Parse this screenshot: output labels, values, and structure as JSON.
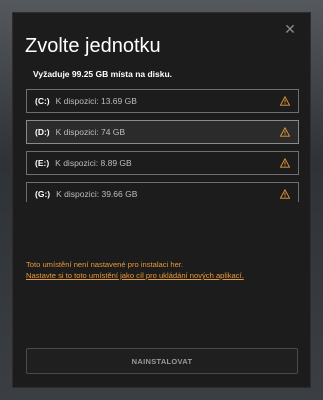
{
  "dialog": {
    "title": "Zvolte jednotku",
    "requirement": "Vyžaduje 99.25 GB místa na disku.",
    "close_icon": "close-icon"
  },
  "drives": [
    {
      "letter": "(C:)",
      "space": "K dispozici: 13.69 GB",
      "icon": "warning-icon",
      "selected": false
    },
    {
      "letter": "(D:)",
      "space": "K dispozici: 74 GB",
      "icon": "warning-icon",
      "selected": true
    },
    {
      "letter": "(E:)",
      "space": "K dispozici: 8.89 GB",
      "icon": "warning-icon",
      "selected": false
    },
    {
      "letter": "(G:)",
      "space": "K dispozici: 39.66 GB",
      "icon": "warning-icon",
      "selected": false
    }
  ],
  "notice": {
    "text": "Toto umístění není nastavené pro instalaci her.",
    "link": "Nastavte si to toto umístění jako cíl pro ukládání nových aplikací."
  },
  "install_button": "NAINSTALOVAT",
  "colors": {
    "accent_warning": "#e89a3a",
    "dialog_bg": "#1c1c1c"
  }
}
